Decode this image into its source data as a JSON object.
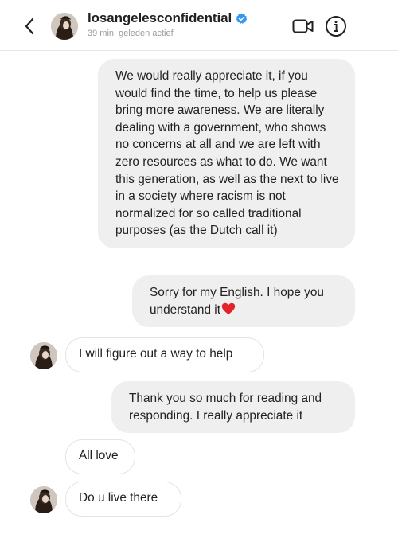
{
  "header": {
    "username": "losangelesconfidential",
    "status": "39 min. geleden actief",
    "verified": true,
    "icons": [
      "back-arrow-icon",
      "verified-badge-icon",
      "video-call-icon",
      "info-icon"
    ]
  },
  "messages": [
    {
      "direction": "outgoing",
      "text": "We would really appreciate it, if you would find the time, to help us please bring more awareness. We are literally dealing with a government, who shows no concerns at all and we are left with zero resources as what to do. We want this generation, as well as the next to live in a society where racism is not normalized for so called traditional purposes (as the Dutch call it)"
    },
    {
      "direction": "outgoing",
      "text": "Sorry for my English. I hope you understand it",
      "emoji": "red-heart-icon"
    },
    {
      "direction": "incoming",
      "text": "I will figure out a way to help"
    },
    {
      "direction": "outgoing",
      "text": "Thank you so much for reading and responding. I really appreciate it"
    },
    {
      "direction": "incoming",
      "text": "All love"
    },
    {
      "direction": "incoming",
      "text": "Do u live there"
    }
  ],
  "colors": {
    "outgoing_bubble": "#efefef",
    "incoming_border": "#e3e3e3",
    "verified_blue": "#3897f0",
    "heart_red": "#e0242a",
    "status_gray": "#9a9a9a"
  }
}
